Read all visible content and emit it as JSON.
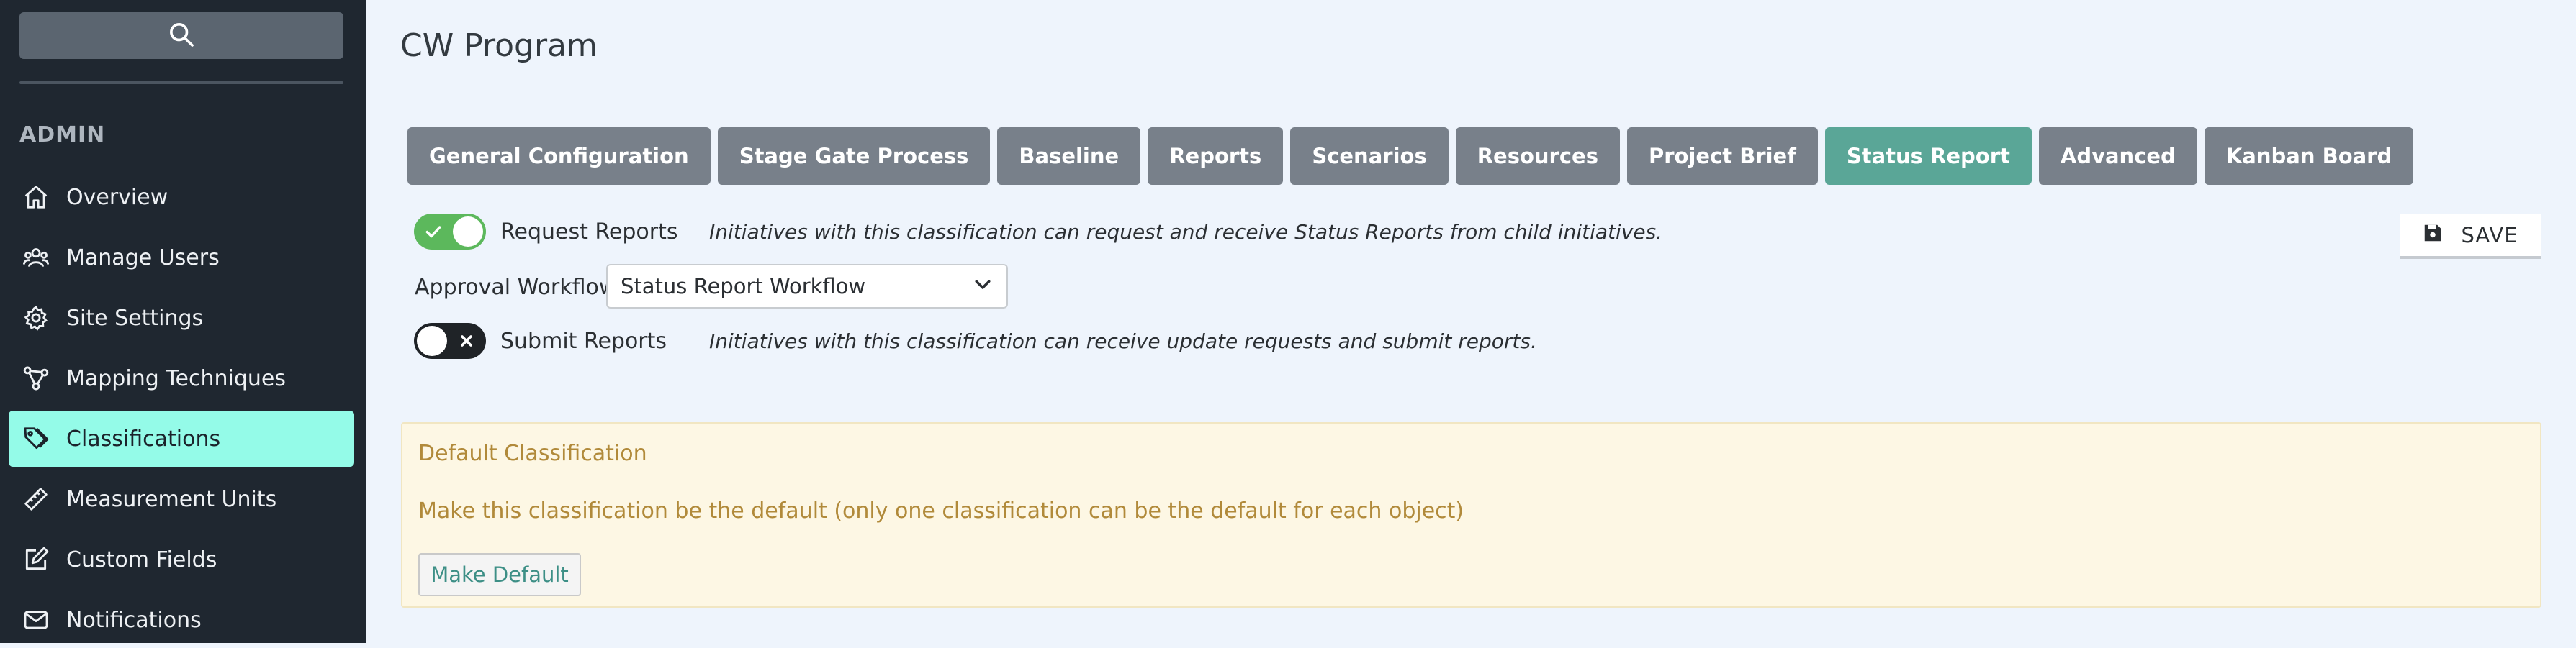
{
  "sidebar": {
    "search_icon": "search-icon",
    "section_heading": "ADMIN",
    "items": [
      {
        "label": "Overview",
        "icon": "home-icon"
      },
      {
        "label": "Manage Users",
        "icon": "users-icon"
      },
      {
        "label": "Site Settings",
        "icon": "gear-icon"
      },
      {
        "label": "Mapping Techniques",
        "icon": "network-icon"
      },
      {
        "label": "Classifications",
        "icon": "tags-icon",
        "active": true
      },
      {
        "label": "Measurement Units",
        "icon": "ruler-icon"
      },
      {
        "label": "Custom Fields",
        "icon": "edit-icon"
      },
      {
        "label": "Notifications",
        "icon": "envelope-icon"
      }
    ]
  },
  "header": {
    "title": "CW Program"
  },
  "tabs": [
    "General Configuration",
    "Stage Gate Process",
    "Baseline",
    "Reports",
    "Scenarios",
    "Resources",
    "Project Brief",
    "Status Report",
    "Advanced",
    "Kanban Board"
  ],
  "active_tab": "Status Report",
  "status_report": {
    "request_reports": {
      "label": "Request Reports",
      "enabled": true,
      "description": "Initiatives with this classification can request and receive Status Reports from child initiatives."
    },
    "approval_workflow": {
      "label": "Approval Workflow",
      "value": "Status Report Workflow"
    },
    "submit_reports": {
      "label": "Submit Reports",
      "enabled": false,
      "description": "Initiatives with this classification can receive update requests and submit reports."
    },
    "save_label": "SAVE"
  },
  "default_classification": {
    "title": "Default Classification",
    "text": "Make this classification be the default (only one classification can be the default for each object)",
    "button_label": "Make Default"
  },
  "colors": {
    "sidebar_bg": "#1f2730",
    "active_nav": "#94fbe8",
    "tab_bg": "#78808a",
    "active_tab": "#5aa697",
    "toggle_on": "#5cb85c",
    "panel_text": "#b18a3a"
  }
}
